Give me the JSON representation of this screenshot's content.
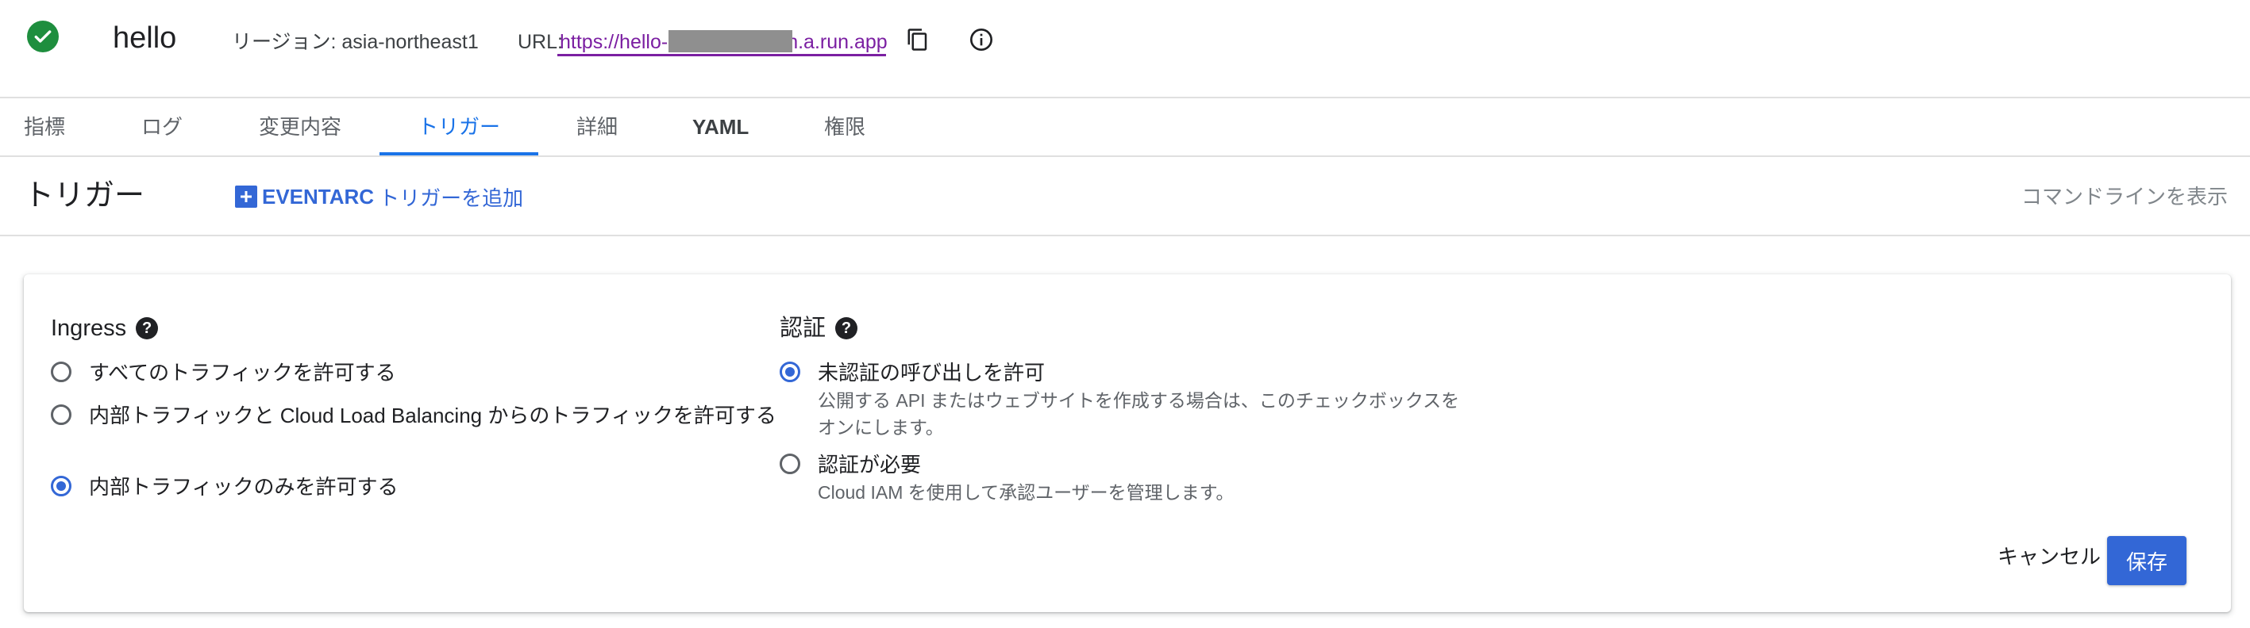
{
  "header": {
    "service_name": "hello",
    "region": "リージョン: asia-northeast1",
    "url_label": "URL:",
    "url_start": "https://hello-",
    "url_end": "n.a.run.app",
    "status_icon": "check-circle-icon",
    "copy_icon": "content-copy-icon",
    "info_icon": "info-icon"
  },
  "tabs": [
    {
      "label": "指標"
    },
    {
      "label": "ログ"
    },
    {
      "label": "変更内容"
    },
    {
      "label": "トリガー",
      "active": true
    },
    {
      "label": "詳細"
    },
    {
      "label": "YAML"
    },
    {
      "label": "権限"
    }
  ],
  "toolbar": {
    "title": "トリガー",
    "add_trigger_bold": "EVENTARC",
    "add_trigger_rest": "トリガーを追加",
    "cli_link": "コマンドラインを表示"
  },
  "ingress": {
    "title": "Ingress",
    "options": [
      {
        "label": "すべてのトラフィックを許可する",
        "selected": false
      },
      {
        "label": "内部トラフィックと Cloud Load Balancing からのトラフィックを許可する",
        "selected": false
      },
      {
        "label": "内部トラフィックのみを許可する",
        "selected": true
      }
    ]
  },
  "auth": {
    "title": "認証",
    "options": [
      {
        "label": "未認証の呼び出しを許可",
        "description": "公開する API またはウェブサイトを作成する場合は、このチェックボックスをオンにします。",
        "selected": true
      },
      {
        "label": "認証が必要",
        "description": "Cloud IAM を使用して承認ユーザーを管理します。",
        "selected": false
      }
    ]
  },
  "actions": {
    "cancel": "キャンセル",
    "save": "保存"
  },
  "colors": {
    "accent": "#3367d6",
    "success": "#1e8e3e",
    "link_visited": "#7b1fa2"
  }
}
